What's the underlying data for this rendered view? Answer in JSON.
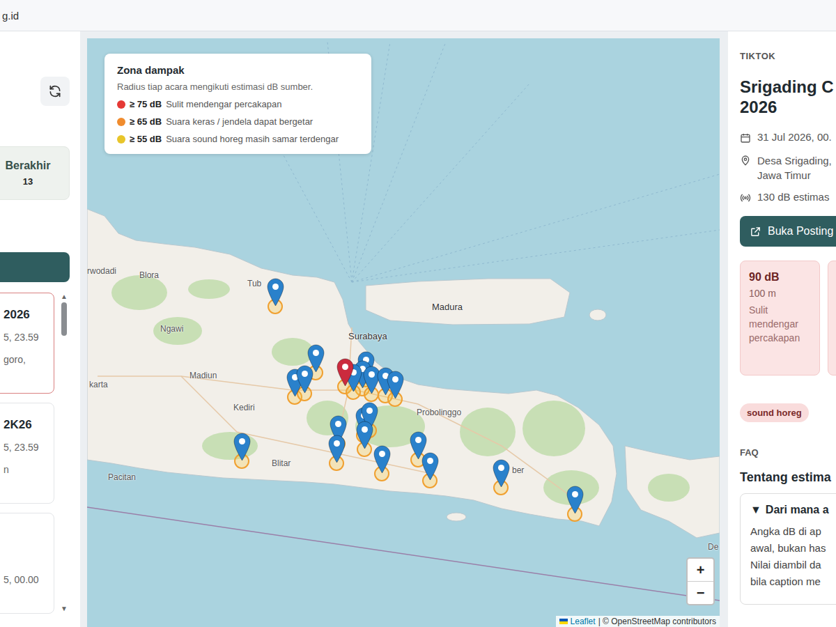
{
  "browser": {
    "url": "g.id"
  },
  "sidebar": {
    "stat": {
      "label": "Berakhir",
      "count": "13"
    },
    "events": [
      {
        "title": "2026",
        "time": "5, 23.59",
        "place": "goro,",
        "selected": true
      },
      {
        "title": "2K26",
        "time": "5, 23.59",
        "place": "n",
        "selected": false
      },
      {
        "time": "5, 00.00",
        "selected": false
      }
    ],
    "scroll": {
      "up": "▲",
      "down": "▼"
    }
  },
  "map": {
    "legend": {
      "title": "Zona dampak",
      "subtitle": "Radius tiap acara mengikuti estimasi dB sumber.",
      "items": [
        {
          "threshold": "≥ 75 dB",
          "label": "Sulit mendengar percakapan",
          "color": "#e53935"
        },
        {
          "threshold": "≥ 65 dB",
          "label": "Suara keras / jendela dapat bergetar",
          "color": "#f08c2e"
        },
        {
          "threshold": "≥ 55 dB",
          "label": "Suara sound horeg masih samar terdengar",
          "color": "#e8c52a"
        }
      ]
    },
    "labels": [
      {
        "text": "rwodadi"
      },
      {
        "text": "Blora"
      },
      {
        "text": "Tub"
      },
      {
        "text": "Surabaya"
      },
      {
        "text": "Madura"
      },
      {
        "text": "Ngawi"
      },
      {
        "text": "karta"
      },
      {
        "text": "Madiun"
      },
      {
        "text": "Kediri"
      },
      {
        "text": "Blitar"
      },
      {
        "text": "Pacitan"
      },
      {
        "text": "Probolinggo"
      },
      {
        "text": "ber"
      },
      {
        "text": "De"
      }
    ],
    "pins": [
      {
        "color": "#2a81cb",
        "selected": false
      },
      {
        "color": "#2a81cb",
        "selected": false
      },
      {
        "color": "#2a81cb",
        "selected": false
      },
      {
        "color": "#2a81cb",
        "selected": false
      },
      {
        "color": "#cb2b3e",
        "selected": true
      },
      {
        "color": "#2a81cb",
        "selected": false
      },
      {
        "color": "#2a81cb",
        "selected": false
      },
      {
        "color": "#2a81cb",
        "selected": false
      },
      {
        "color": "#2a81cb",
        "selected": false
      },
      {
        "color": "#2a81cb",
        "selected": false
      },
      {
        "color": "#2a81cb",
        "selected": false
      },
      {
        "color": "#2a81cb",
        "selected": false
      },
      {
        "color": "#2a81cb",
        "selected": false
      },
      {
        "color": "#2a81cb",
        "selected": false
      },
      {
        "color": "#2a81cb",
        "selected": false
      },
      {
        "color": "#2a81cb",
        "selected": false
      },
      {
        "color": "#2a81cb",
        "selected": false
      },
      {
        "color": "#2a81cb",
        "selected": false
      },
      {
        "color": "#2a81cb",
        "selected": false
      },
      {
        "color": "#2a81cb",
        "selected": false
      },
      {
        "color": "#2a81cb",
        "selected": false
      },
      {
        "color": "#2a81cb",
        "selected": false
      }
    ],
    "zoom": {
      "in": "+",
      "out": "−"
    },
    "attribution": {
      "leaflet": "Leaflet",
      "rest": "| © OpenStreetMap contributors"
    }
  },
  "detail": {
    "source": "TIKTOK",
    "title_lines": [
      "Srigading C",
      "2026"
    ],
    "date": "31 Jul 2026, 00.",
    "location_lines": [
      "Desa Srigading,",
      "Jawa Timur"
    ],
    "estimate": "130 dB estimas",
    "button": "Buka Posting",
    "zones": [
      {
        "db": "90 dB",
        "distance": "100 m",
        "description": "Sulit mendengar percakapan",
        "color": "#fbe4e4"
      },
      {
        "color": "#fbe4e4"
      }
    ],
    "tags": [
      {
        "label": "sound horeg",
        "color": "#f9dcdc"
      }
    ],
    "faq": {
      "heading": "FAQ",
      "title": "Tentang estima",
      "marker": "▼",
      "question": "Dari mana a",
      "answer_lines": [
        "Angka dB di ap",
        "awal, bukan has",
        "Nilai diambil da",
        "bila caption me"
      ]
    }
  }
}
